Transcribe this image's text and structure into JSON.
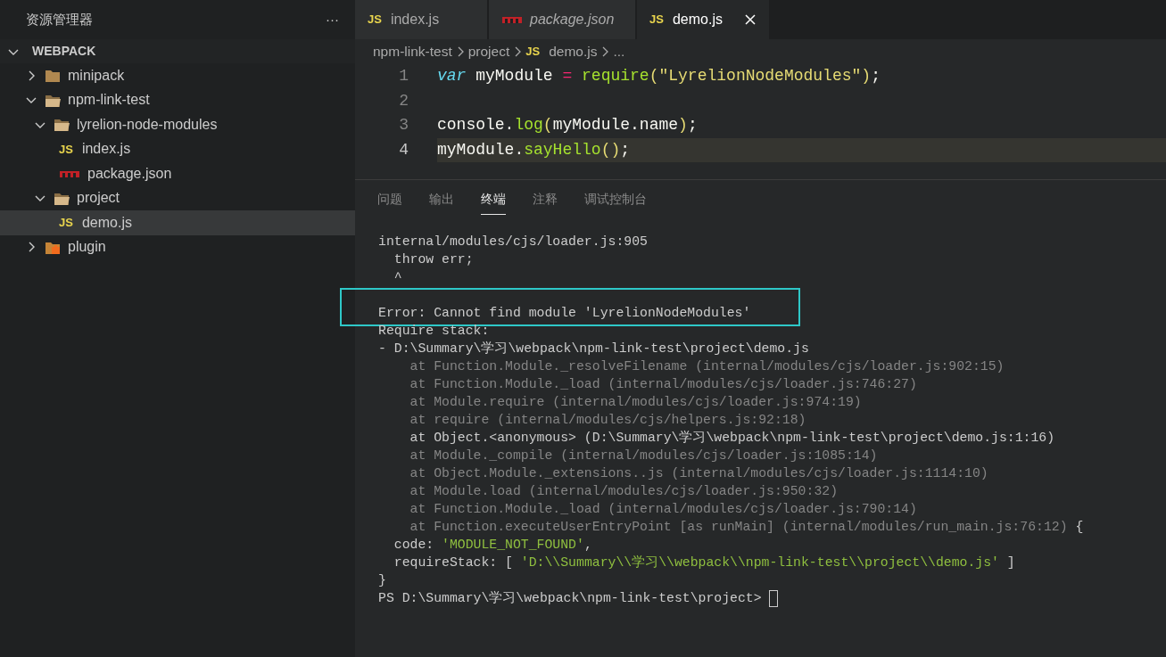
{
  "sidebar": {
    "title": "资源管理器",
    "more": "···",
    "root": {
      "label": "WEBPACK",
      "expanded": true
    },
    "tree": [
      {
        "label": "minipack",
        "kind": "folder",
        "expanded": false,
        "selected": false
      },
      {
        "label": "npm-link-test",
        "kind": "folder",
        "expanded": true,
        "selected": false,
        "children": [
          {
            "label": "lyrelion-node-modules",
            "kind": "folder",
            "expanded": true,
            "selected": false,
            "children": [
              {
                "label": "index.js",
                "kind": "js",
                "badge": "JS",
                "selected": false
              },
              {
                "label": "package.json",
                "kind": "npm",
                "selected": false
              }
            ]
          },
          {
            "label": "project",
            "kind": "folder",
            "expanded": true,
            "selected": false,
            "children": [
              {
                "label": "demo.js",
                "kind": "js",
                "badge": "JS",
                "selected": true
              }
            ]
          }
        ]
      },
      {
        "label": "plugin",
        "kind": "plugin",
        "expanded": false,
        "selected": false
      }
    ]
  },
  "tabs": [
    {
      "label": "index.js",
      "kind": "js",
      "badge": "JS",
      "preview": false,
      "selected": false
    },
    {
      "label": "package.json",
      "kind": "npm",
      "preview": true,
      "selected": false
    },
    {
      "label": "demo.js",
      "kind": "js",
      "badge": "JS",
      "preview": false,
      "selected": true
    }
  ],
  "breadcrumb": [
    {
      "label": "npm-link-test"
    },
    {
      "label": "project"
    },
    {
      "label": "demo.js",
      "badge": "JS"
    },
    {
      "label": "..."
    }
  ],
  "code": [
    {
      "number": "1",
      "current": false,
      "tokens": [
        {
          "text": "var",
          "kind": "keyword"
        },
        {
          "text": " myModule",
          "kind": "plain"
        },
        {
          "text": " = ",
          "kind": "operator"
        },
        {
          "text": "require",
          "kind": "func"
        },
        {
          "text": "(",
          "kind": "paren"
        },
        {
          "text": "\"LyrelionNodeModules\"",
          "kind": "string"
        },
        {
          "text": ")",
          "kind": "paren"
        },
        {
          "text": ";",
          "kind": "plain"
        }
      ]
    },
    {
      "number": "2",
      "current": false
    },
    {
      "number": "3",
      "current": false,
      "tokens": [
        {
          "text": "console.",
          "kind": "plain"
        },
        {
          "text": "log",
          "kind": "func"
        },
        {
          "text": "(",
          "kind": "paren"
        },
        {
          "text": "myModule.name",
          "kind": "plain"
        },
        {
          "text": ")",
          "kind": "paren"
        },
        {
          "text": ";",
          "kind": "plain"
        }
      ]
    },
    {
      "number": "4",
      "current": true,
      "tokens": [
        {
          "text": "myModule.",
          "kind": "plain"
        },
        {
          "text": "sayHello",
          "kind": "func"
        },
        {
          "text": "()",
          "kind": "paren"
        },
        {
          "text": ";",
          "kind": "plain"
        }
      ]
    }
  ],
  "panel_tabs": [
    {
      "label": "问题",
      "selected": false
    },
    {
      "label": "输出",
      "selected": false
    },
    {
      "label": "终端",
      "selected": true
    },
    {
      "label": "注释",
      "selected": false
    },
    {
      "label": "调试控制台",
      "selected": false
    }
  ],
  "terminal": [
    {
      "kind": "text",
      "parts": [
        {
          "text": "internal/modules/cjs/loader.js:905",
          "kind": "normal"
        }
      ]
    },
    {
      "kind": "text",
      "parts": [
        {
          "text": "  throw err;",
          "kind": "normal"
        }
      ]
    },
    {
      "kind": "text",
      "parts": [
        {
          "text": "  ^",
          "kind": "normal"
        }
      ]
    },
    {
      "kind": "blank"
    },
    {
      "kind": "text",
      "highlighted": true,
      "parts": [
        {
          "text": "Error: Cannot find module 'LyrelionNodeModules'",
          "kind": "normal"
        }
      ]
    },
    {
      "kind": "text",
      "parts": [
        {
          "text": "Require stack:",
          "kind": "normal"
        }
      ]
    },
    {
      "kind": "text",
      "parts": [
        {
          "text": "- D:\\Summary\\学习\\webpack\\npm-link-test\\project\\demo.js",
          "kind": "normal"
        }
      ]
    },
    {
      "kind": "text",
      "parts": [
        {
          "text": "    at Function.Module._resolveFilename (internal/modules/cjs/loader.js:902:15)",
          "kind": "dim"
        }
      ]
    },
    {
      "kind": "text",
      "parts": [
        {
          "text": "    at Function.Module._load (internal/modules/cjs/loader.js:746:27)",
          "kind": "dim"
        }
      ]
    },
    {
      "kind": "text",
      "parts": [
        {
          "text": "    at Module.require (internal/modules/cjs/loader.js:974:19)",
          "kind": "dim"
        }
      ]
    },
    {
      "kind": "text",
      "parts": [
        {
          "text": "    at require (internal/modules/cjs/helpers.js:92:18)",
          "kind": "dim"
        }
      ]
    },
    {
      "kind": "text",
      "parts": [
        {
          "text": "    at Object.<anonymous> (D:\\Summary\\学习\\webpack\\npm-link-test\\project\\demo.js:1:16)",
          "kind": "normal"
        }
      ]
    },
    {
      "kind": "text",
      "parts": [
        {
          "text": "    at Module._compile (internal/modules/cjs/loader.js:1085:14)",
          "kind": "dim"
        }
      ]
    },
    {
      "kind": "text",
      "parts": [
        {
          "text": "    at Object.Module._extensions..js (internal/modules/cjs/loader.js:1114:10)",
          "kind": "dim"
        }
      ]
    },
    {
      "kind": "text",
      "parts": [
        {
          "text": "    at Module.load (internal/modules/cjs/loader.js:950:32)",
          "kind": "dim"
        }
      ]
    },
    {
      "kind": "text",
      "parts": [
        {
          "text": "    at Function.Module._load (internal/modules/cjs/loader.js:790:14)",
          "kind": "dim"
        }
      ]
    },
    {
      "kind": "text",
      "parts": [
        {
          "text": "    at Function.executeUserEntryPoint [as runMain] (internal/modules/run_main.js:76:12)",
          "kind": "dim"
        },
        {
          "text": " {",
          "kind": "normal"
        }
      ]
    },
    {
      "kind": "text",
      "parts": [
        {
          "text": "  code: ",
          "kind": "normal"
        },
        {
          "text": "'MODULE_NOT_FOUND'",
          "kind": "string"
        },
        {
          "text": ",",
          "kind": "normal"
        }
      ]
    },
    {
      "kind": "text",
      "parts": [
        {
          "text": "  requireStack: [ ",
          "kind": "normal"
        },
        {
          "text": "'D:\\\\Summary\\\\学习\\\\webpack\\\\npm-link-test\\\\project\\\\demo.js'",
          "kind": "string"
        },
        {
          "text": " ]",
          "kind": "normal"
        }
      ]
    },
    {
      "kind": "text",
      "parts": [
        {
          "text": "}",
          "kind": "normal"
        }
      ]
    },
    {
      "kind": "text",
      "cursor": true,
      "parts": [
        {
          "text": "PS D:\\Summary\\学习\\webpack\\npm-link-test\\project> ",
          "kind": "normal"
        }
      ]
    }
  ]
}
